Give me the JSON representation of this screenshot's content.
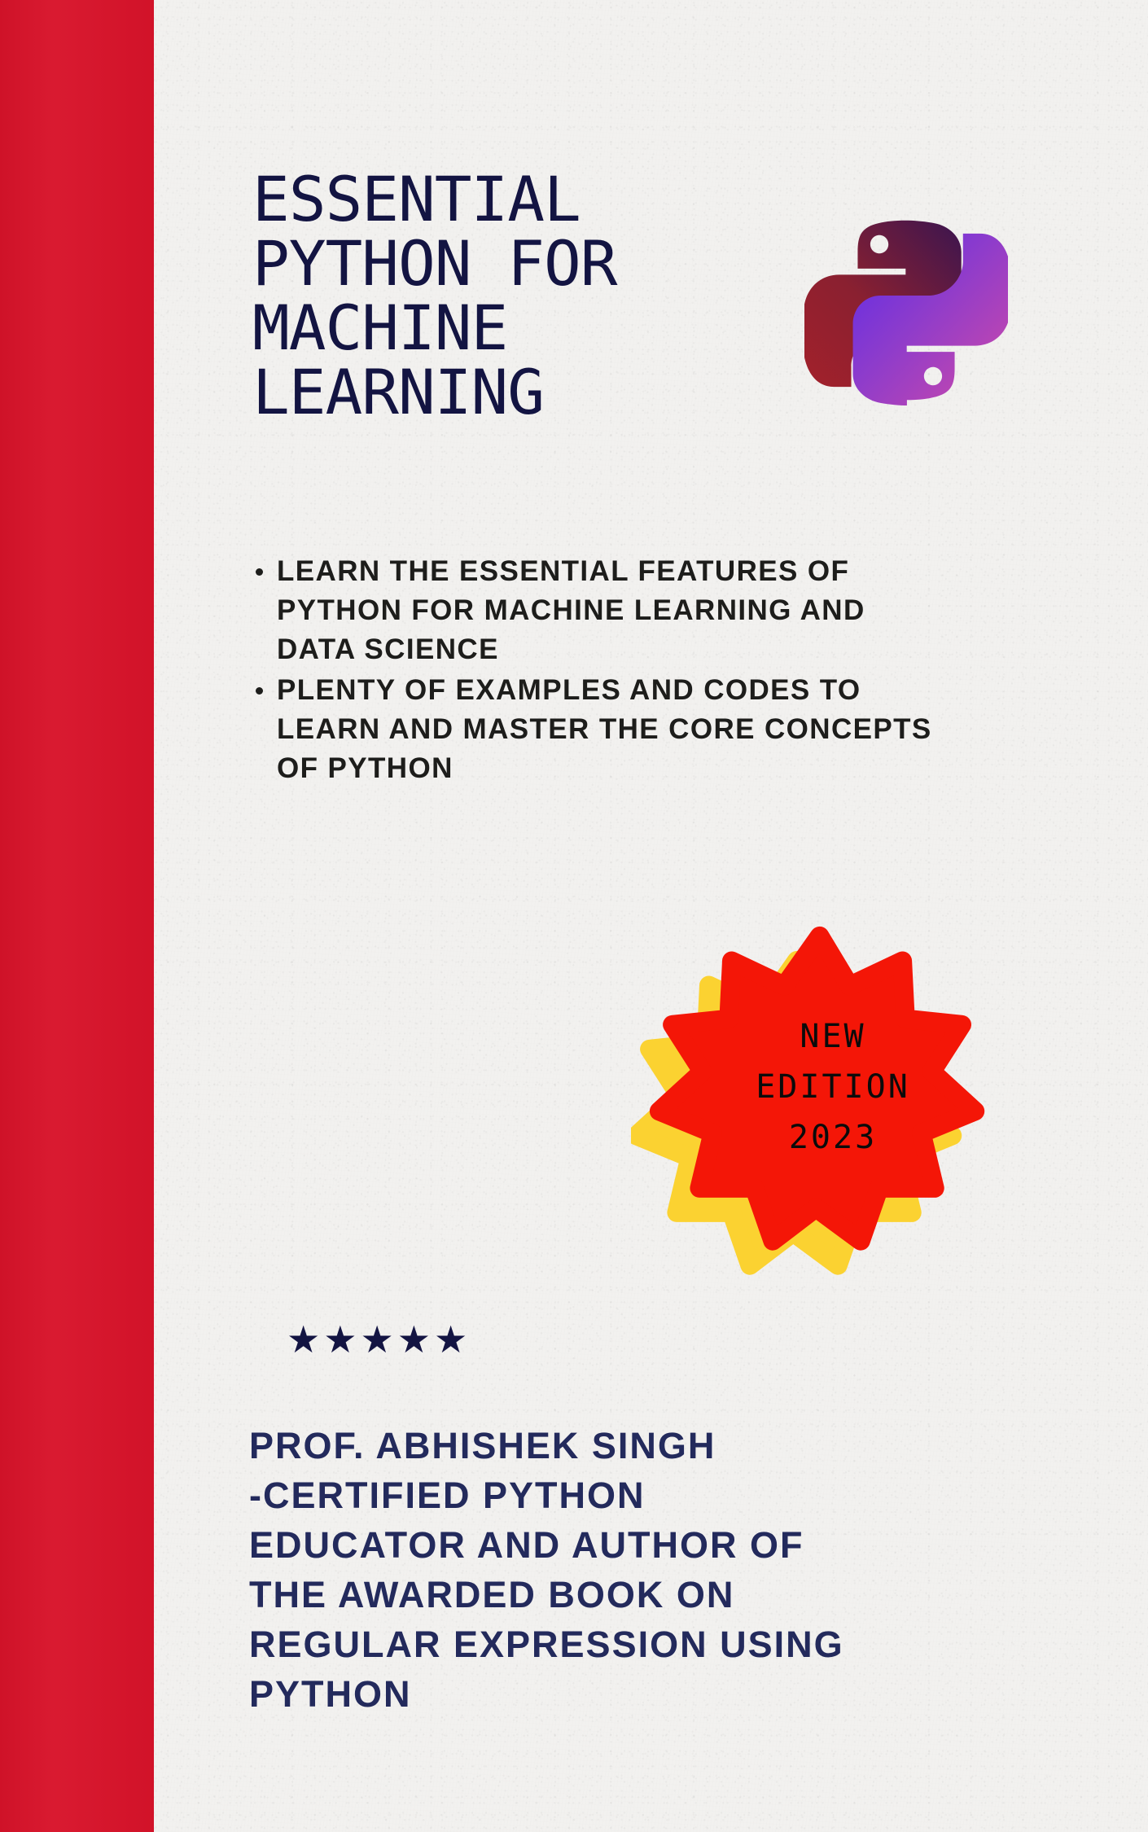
{
  "cover": {
    "title": "ESSENTIAL\nPYTHON FOR\nMACHINE\nLEARNING",
    "bullets": [
      "LEARN THE ESSENTIAL FEATURES OF PYTHON FOR MACHINE LEARNING AND DATA SCIENCE",
      "PLENTY OF EXAMPLES AND CODES TO LEARN AND MASTER THE CORE CONCEPTS OF PYTHON"
    ],
    "badge": {
      "line1": "NEW",
      "line2": "EDITION",
      "line3": "2023"
    },
    "rating_stars": "★★★★★",
    "author": "PROF. ABHISHEK SINGH\n-CERTIFIED PYTHON\nEDUCATOR AND AUTHOR OF\nTHE AWARDED BOOK ON\nREGULAR EXPRESSION USING\nPYTHON",
    "colors": {
      "background": "#f2f1ef",
      "stripe_red": "#d8132a",
      "title_navy": "#131442",
      "bullet_text": "#1d1d1b",
      "author_navy": "#232a5c",
      "badge_red": "#f41607",
      "badge_yellow": "#fbd231",
      "badge_text": "#0b0b0b",
      "python_logo_top": "#8a1d24",
      "python_logo_bottom": "#c23ba3"
    }
  }
}
